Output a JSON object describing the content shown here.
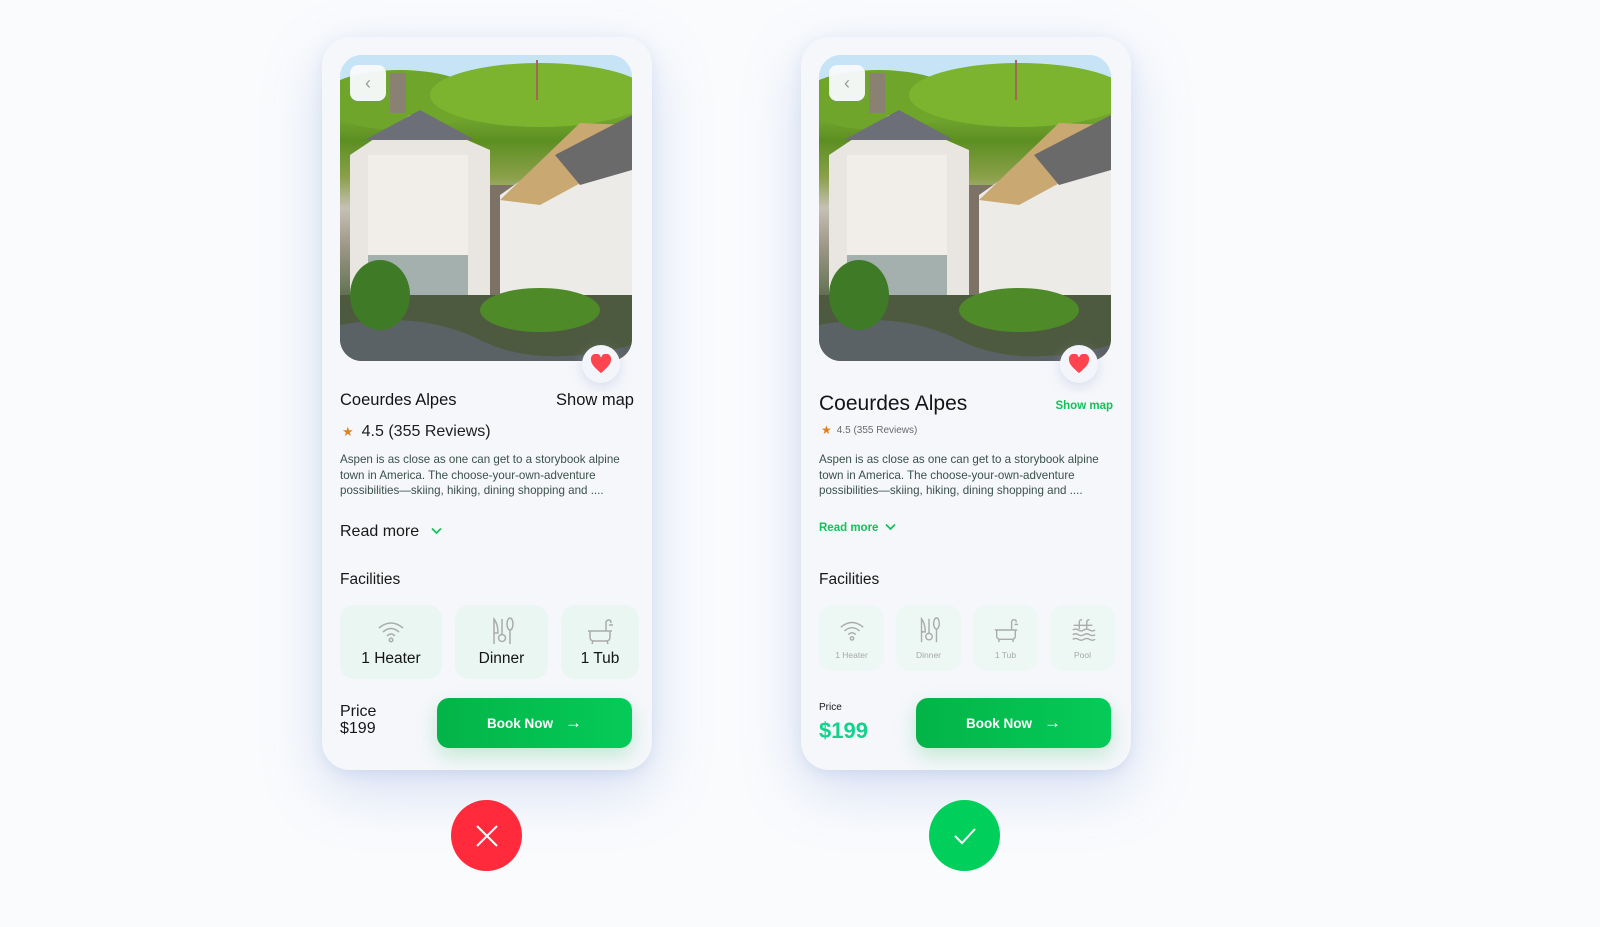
{
  "colors": {
    "accent_green": "#13c25a",
    "price_green": "#14d18b",
    "heart_red": "#ff4450",
    "star_orange": "#e0821e",
    "bad_badge": "#ff2a3b",
    "good_badge": "#00cf5c"
  },
  "cards": [
    {
      "variant": "bad",
      "title": "Coeurdes Alpes",
      "show_map": "Show map",
      "rating": "4.5 (355 Reviews)",
      "description": "Aspen is as close as one can get to a storybook alpine town in America. The choose-your-own-adventure possibilities—skiing, hiking, dining shopping and ....",
      "read_more": "Read more",
      "facilities_title": "Facilities",
      "facilities": [
        {
          "icon": "wifi-icon",
          "label": "1 Heater"
        },
        {
          "icon": "cutlery-icon",
          "label": "Dinner"
        },
        {
          "icon": "bathtub-icon",
          "label": "1 Tub"
        }
      ],
      "price_label": "Price",
      "price_value": "$199",
      "book_label": "Book Now",
      "verdict": "x-icon"
    },
    {
      "variant": "good",
      "title": "Coeurdes Alpes",
      "show_map": "Show map",
      "rating": "4.5 (355 Reviews)",
      "description": "Aspen is as close as one can get to a storybook alpine town in America. The choose-your-own-adventure possibilities—skiing, hiking, dining shopping and ....",
      "read_more": "Read more",
      "facilities_title": "Facilities",
      "facilities": [
        {
          "icon": "wifi-icon",
          "label": "1 Heater"
        },
        {
          "icon": "cutlery-icon",
          "label": "Dinner"
        },
        {
          "icon": "bathtub-icon",
          "label": "1 Tub"
        },
        {
          "icon": "pool-icon",
          "label": "Pool"
        }
      ],
      "price_label": "Price",
      "price_value": "$199",
      "book_label": "Book Now",
      "verdict": "check-icon"
    }
  ]
}
